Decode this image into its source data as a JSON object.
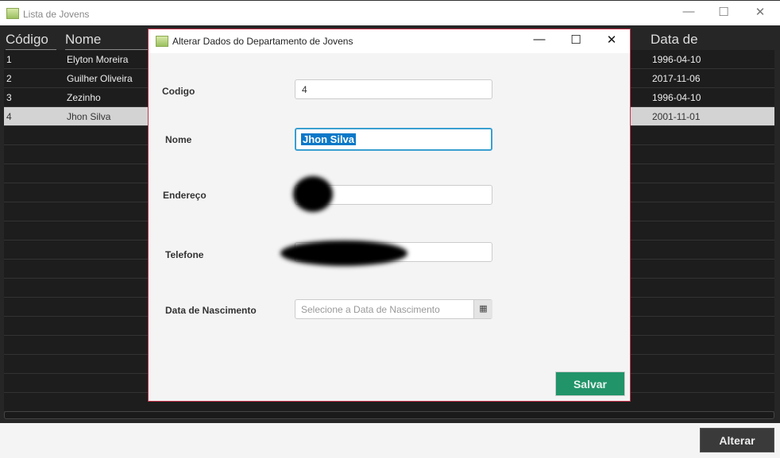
{
  "window": {
    "title": "Lista de Jovens"
  },
  "table": {
    "headers": [
      "Código",
      "Nome",
      "Data de Nascimento"
    ],
    "rows": [
      {
        "codigo": "1",
        "nome": "Elyton Moreira",
        "data": "1996-04-10"
      },
      {
        "codigo": "2",
        "nome": "Guilher Oliveira",
        "data": "2017-11-06"
      },
      {
        "codigo": "3",
        "nome": "Zezinho",
        "data": "1996-04-10"
      },
      {
        "codigo": "4",
        "nome": "Jhon Silva",
        "data": "2001-11-01"
      }
    ]
  },
  "footer": {
    "alterar_label": "Alterar"
  },
  "dialog": {
    "title": "Alterar Dados do Departamento de Jovens",
    "labels": {
      "codigo": "Codigo",
      "nome": "Nome",
      "endereco": "Endereço",
      "telefone": "Telefone",
      "data": "Data de Nascimento"
    },
    "values": {
      "codigo": "4",
      "nome": "Jhon Silva"
    },
    "placeholders": {
      "data": "Selecione a Data de Nascimento"
    },
    "salvar_label": "Salvar"
  }
}
